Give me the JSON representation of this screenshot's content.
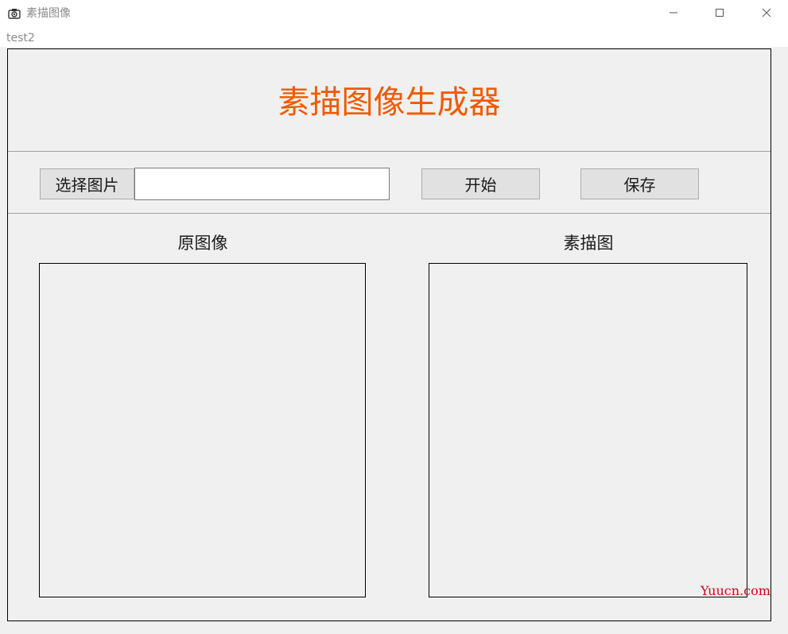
{
  "window": {
    "title": "素描图像",
    "icon": "camera-icon"
  },
  "menu": {
    "items": [
      "test2"
    ]
  },
  "header": {
    "title": "素描图像生成器",
    "title_color": "#f05a00"
  },
  "toolbar": {
    "select_label": "选择图片",
    "path_value": "",
    "start_label": "开始",
    "save_label": "保存"
  },
  "panels": {
    "original_label": "原图像",
    "sketch_label": "素描图"
  },
  "watermark": {
    "text": "Yuucn.com",
    "color": "#d9001b"
  }
}
